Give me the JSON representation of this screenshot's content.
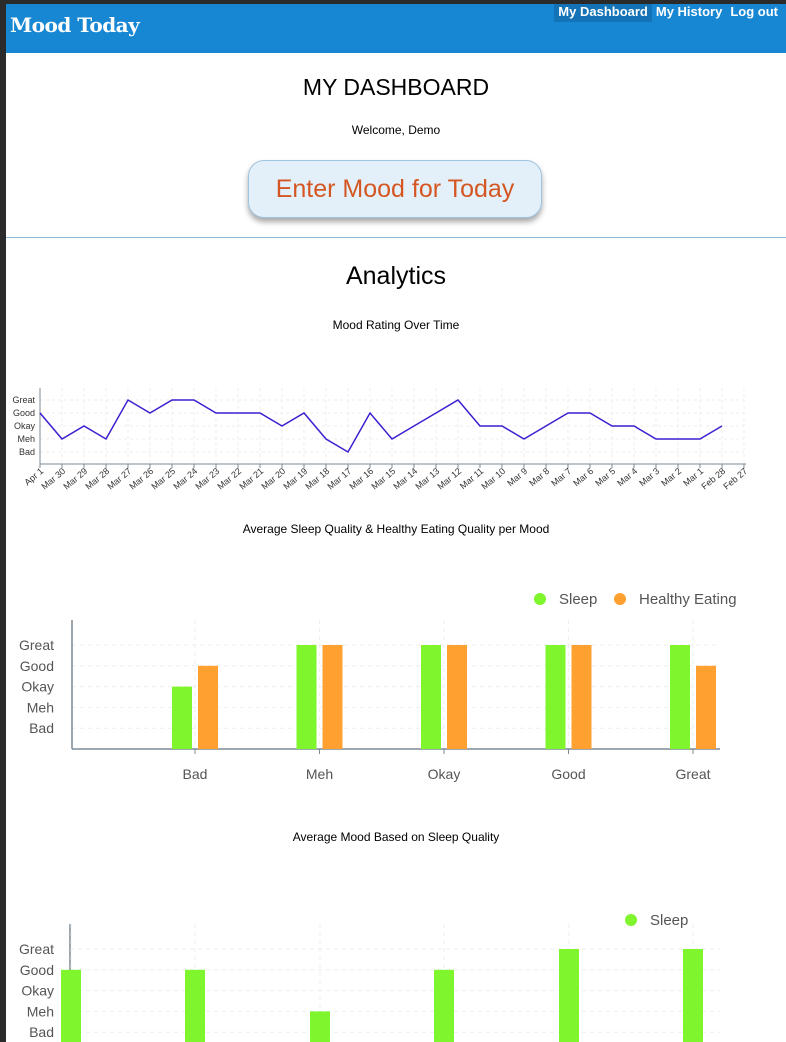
{
  "app": {
    "title": "Mood Today"
  },
  "nav": {
    "dashboard": "My Dashboard",
    "history": "My History",
    "logout": "Log out"
  },
  "header": {
    "title": "MY DASHBOARD",
    "welcome": "Welcome, Demo",
    "enter_mood": "Enter Mood for Today"
  },
  "analytics": {
    "title": "Analytics"
  },
  "colors": {
    "nav": "#1787d4",
    "line": "#3d1fd1",
    "sleep": "#7ef52d",
    "eating": "#ffa030",
    "button_text": "#d45723"
  },
  "chart_data": [
    {
      "type": "line",
      "title": "Mood Rating Over Time",
      "y_categories": [
        "Bad",
        "Meh",
        "Okay",
        "Good",
        "Great"
      ],
      "x": [
        "Apr 1",
        "Mar 30",
        "Mar 29",
        "Mar 28",
        "Mar 27",
        "Mar 26",
        "Mar 25",
        "Mar 24",
        "Mar 23",
        "Mar 22",
        "Mar 21",
        "Mar 20",
        "Mar 19",
        "Mar 18",
        "Mar 17",
        "Mar 16",
        "Mar 15",
        "Mar 14",
        "Mar 13",
        "Mar 12",
        "Mar 11",
        "Mar 10",
        "Mar 9",
        "Mar 8",
        "Mar 7",
        "Mar 6",
        "Mar 5",
        "Mar 4",
        "Mar 3",
        "Mar 2",
        "Mar 1",
        "Feb 28",
        "Feb 27"
      ],
      "values": [
        "Good",
        "Meh",
        "Okay",
        "Meh",
        "Great",
        "Good",
        "Great",
        "Great",
        "Good",
        "Good",
        "Good",
        "Okay",
        "Good",
        "Meh",
        "Bad",
        "Good",
        "Meh",
        "Okay",
        "Good",
        "Great",
        "Okay",
        "Okay",
        "Meh",
        "Okay",
        "Good",
        "Good",
        "Okay",
        "Okay",
        "Meh",
        "Meh",
        "Meh",
        "Okay"
      ],
      "grid": true
    },
    {
      "type": "bar",
      "title": "Average Sleep Quality & Healthy Eating Quality per Mood",
      "categories": [
        "Bad",
        "Meh",
        "Okay",
        "Good",
        "Great"
      ],
      "y_categories": [
        "Bad",
        "Meh",
        "Okay",
        "Good",
        "Great"
      ],
      "series": [
        {
          "name": "Sleep",
          "values": [
            3,
            5,
            5,
            5,
            5
          ]
        },
        {
          "name": "Healthy Eating",
          "values": [
            4,
            5,
            5,
            5,
            4
          ]
        }
      ],
      "legend": "top-right"
    },
    {
      "type": "bar",
      "title": "Average Mood Based on Sleep Quality",
      "y_categories": [
        "Bad",
        "Meh",
        "Okay",
        "Good",
        "Great"
      ],
      "series": [
        {
          "name": "Sleep",
          "values": [
            4,
            4,
            2,
            4,
            5,
            5
          ]
        }
      ],
      "legend": "top-right"
    }
  ]
}
